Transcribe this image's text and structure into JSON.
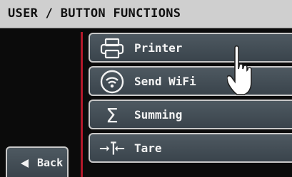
{
  "header": {
    "title": "USER / BUTTON FUNCTIONS"
  },
  "menu": {
    "items": [
      {
        "label": "Printer",
        "icon": "printer-icon"
      },
      {
        "label": "Send WiFi",
        "icon": "wifi-icon"
      },
      {
        "label": "Summing",
        "icon": "sigma-icon"
      },
      {
        "label": "Tare",
        "icon": "tare-icon"
      }
    ]
  },
  "back": {
    "label": "Back",
    "icon": "arrow-left-icon"
  },
  "colors": {
    "header_bg": "#cfcfcf",
    "accent_red": "#b3182a",
    "button_bg": "#46515a"
  }
}
